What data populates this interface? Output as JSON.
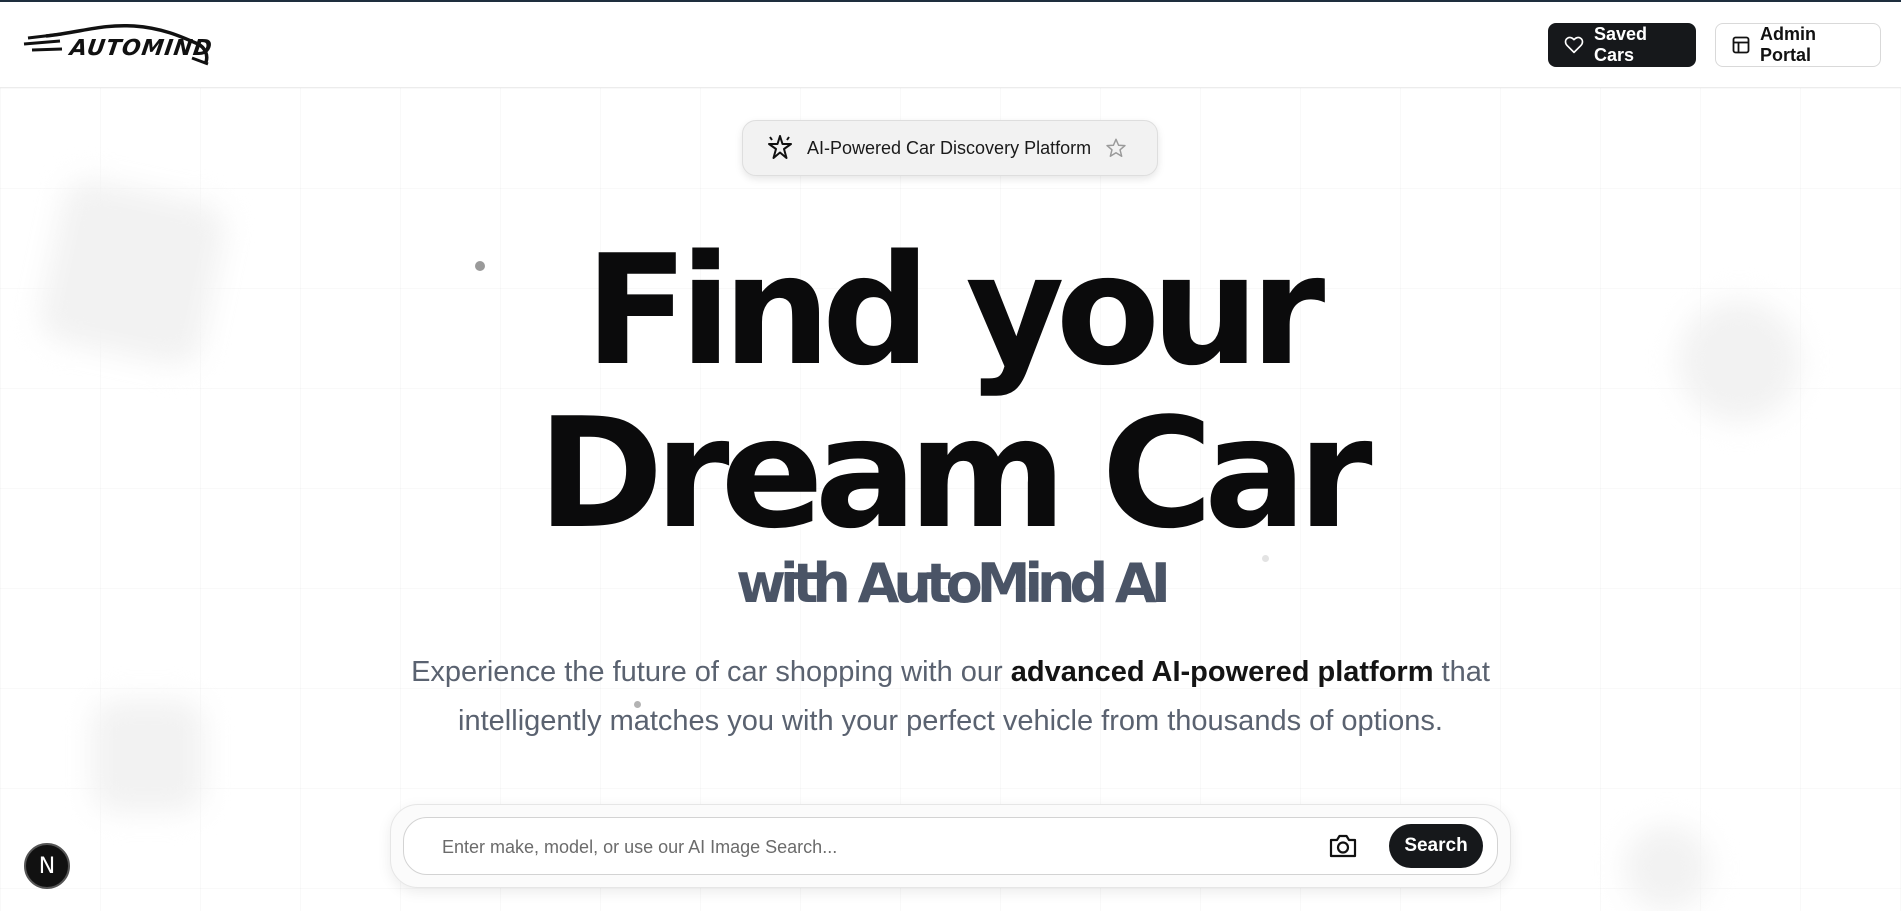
{
  "header": {
    "logo_text": "AUTOMIND",
    "saved_cars_label": "Saved Cars",
    "admin_portal_label": "Admin Portal"
  },
  "hero": {
    "badge_text": "AI-Powered Car Discovery Platform",
    "title_line1": "Find your",
    "title_line2": "Dream Car",
    "subtitle": "with AutoMind AI",
    "description_prefix": "Experience the future of car shopping with our ",
    "description_bold": "advanced AI-powered platform",
    "description_suffix": " that intelligently matches you with your perfect vehicle from thousands of options."
  },
  "search": {
    "placeholder": "Enter make, model, or use our AI Image Search...",
    "button_label": "Search"
  },
  "dev_badge": {
    "letter": "N"
  },
  "colors": {
    "primary_dark": "#16181b",
    "subtitle": "#4a5466",
    "description": "#5a6270"
  }
}
